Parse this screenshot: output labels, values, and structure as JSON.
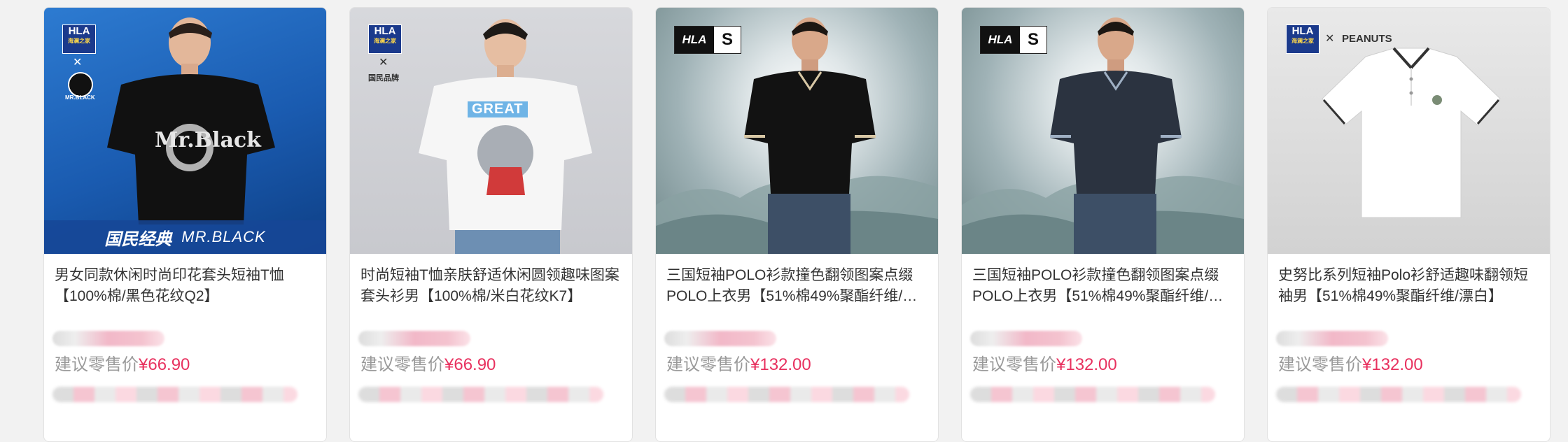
{
  "products": [
    {
      "title": "男女同款休闲时尚印花套头短袖T恤【100%棉/黑色花纹Q2】",
      "price_label": "建议零售价",
      "price": "¥66.90",
      "brand_logo": "HLA",
      "brand_sub": "海澜之家",
      "collab": "MR.BLACK",
      "banner_main": "国民经典",
      "banner_sub": "MR.BLACK",
      "shirt_print": "Mr.Black"
    },
    {
      "title": "时尚短袖T恤亲肤舒适休闲圆领趣味图案套头衫男【100%棉/米白花纹K7】",
      "price_label": "建议零售价",
      "price": "¥66.90",
      "brand_logo": "HLA",
      "brand_sub": "海澜之家",
      "collab": "国民品牌",
      "shirt_print": "GREAT"
    },
    {
      "title": "三国短袖POLO衫款撞色翻领图案点缀POLO上衣男【51%棉49%聚酯纤维/黑色】",
      "price_label": "建议零售价",
      "price": "¥132.00",
      "brand_logo": "HLA",
      "brand_mark": "S"
    },
    {
      "title": "三国短袖POLO衫款撞色翻领图案点缀POLO上衣男【51%棉49%聚酯纤维/藏青】",
      "price_label": "建议零售价",
      "price": "¥132.00",
      "brand_logo": "HLA",
      "brand_mark": "S"
    },
    {
      "title": "史努比系列短袖Polo衫舒适趣味翻领短袖男【51%棉49%聚酯纤维/漂白】",
      "price_label": "建议零售价",
      "price": "¥132.00",
      "brand_logo": "HLA",
      "brand_sub": "海澜之家",
      "collab": "PEANUTS"
    }
  ],
  "colors": {
    "price": "#e8315f",
    "label": "#9a9a9a",
    "title": "#333333",
    "brand_blue": "#1b3a8c"
  }
}
